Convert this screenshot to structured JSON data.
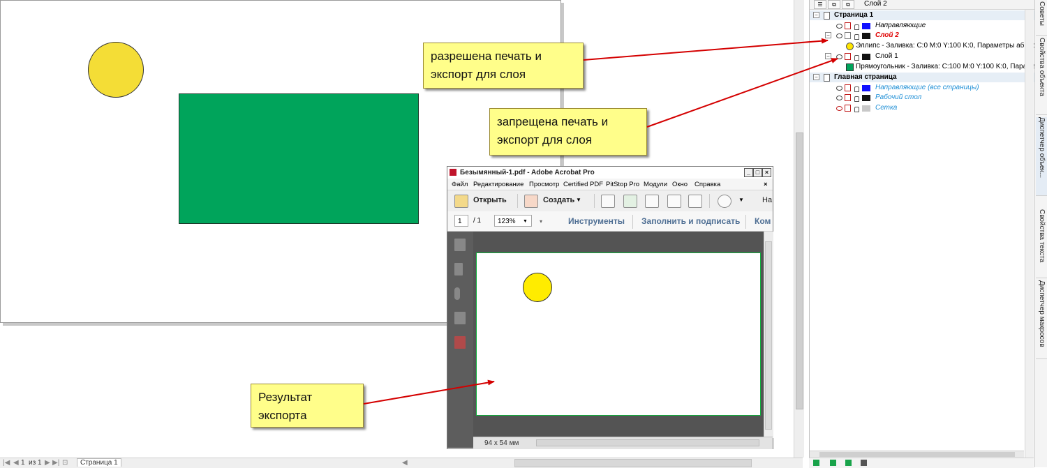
{
  "callouts": {
    "allowed": "разрешена печать и экспорт для слоя",
    "allowed_line1": "разрешена печать и",
    "allowed_line2": "экспорт для слоя",
    "denied_line1": "запрещена печать и",
    "denied_line2": "экспорт для слоя",
    "result_line1": "Результат",
    "result_line2": "экспорта"
  },
  "object_manager": {
    "current_layer": "Слой 2",
    "rows": [
      {
        "label": "Страница 1"
      },
      {
        "label": "Направляющие"
      },
      {
        "label": "Слой 2"
      },
      {
        "label": "Эллипс - Заливка: C:0 M:0 Y:100 K:0, Параметры абриса: С"
      },
      {
        "label": "Слой 1"
      },
      {
        "label": "Прямоугольник - Заливка: C:100 M:0 Y:100 K:0, Параметр"
      },
      {
        "label": "Главная страница"
      },
      {
        "label": "Направляющие (все страницы)"
      },
      {
        "label": "Рабочий стол"
      },
      {
        "label": "Сетка"
      }
    ]
  },
  "dockers": [
    "Советы",
    "Свойства объекта",
    "Диспетчер объек...",
    "Свойства текста",
    "Диспетчер макросов"
  ],
  "status": {
    "page_current": "1",
    "page_of": "из",
    "page_total": "1",
    "page_tab": "Страница 1"
  },
  "acrobat": {
    "title": "Безымянный-1.pdf - Adobe Acrobat Pro",
    "menu": [
      "Файл",
      "Редактирование",
      "Просмотр",
      "Certified PDF",
      "PitStop Pro",
      "Модули",
      "Окно",
      "Справка"
    ],
    "open_label": "Открыть",
    "create_label": "Создать",
    "cut_label": "На",
    "page_input": "1",
    "page_total": "/ 1",
    "zoom": "123%",
    "tools_label": "Инструменты",
    "sign_label": "Заполнить и подписать",
    "comment_label": "Ком",
    "size": "94 x 54 мм",
    "close_x": "×"
  },
  "colors": {
    "ellipse_fill": "#f4dd36",
    "rect_fill": "#00a45b",
    "callout_bg": "#fffe8a",
    "arrow": "#d40000",
    "guides_swatch": "#1010ff",
    "layer_swatch": "#111111",
    "grid_swatch": "#c8c8c8"
  }
}
